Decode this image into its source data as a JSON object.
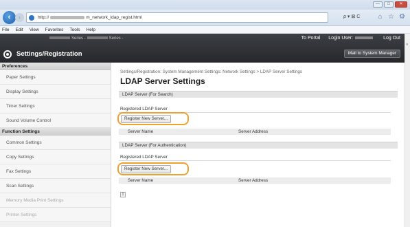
{
  "browser": {
    "back_icon": "back-arrow-icon",
    "url_prefix": "http://",
    "url_suffix": "m_network_ldap_regist.html",
    "search_control": "ρ ▾ ⊠ C",
    "window_controls": [
      "—",
      "□",
      "✕"
    ],
    "toolbar_icons": [
      "⌂",
      "☆",
      "⚙"
    ]
  },
  "menubar": [
    "File",
    "Edit",
    "View",
    "Favorites",
    "Tools",
    "Help"
  ],
  "header": {
    "device_info_left": "Series -",
    "device_info_right": "Series -",
    "to_portal": "To Portal",
    "login_user_label": "Login User:",
    "log_out": "Log Out",
    "title": "Settings/Registration",
    "mail_button": "Mail to System Manager"
  },
  "sidebar": {
    "preferences_heading": "Preferences",
    "preferences_items": [
      "Paper Settings",
      "Display Settings",
      "Timer Settings",
      "Sound Volume Control"
    ],
    "function_heading": "Function Settings",
    "function_items": [
      "Common Settings",
      "Copy Settings",
      "Fax Settings",
      "Scan Settings",
      "Memory Media Print Settings",
      "Printer Settings"
    ]
  },
  "main": {
    "breadcrumb": "Settings/Registration: System Management Settings: Network Settings > LDAP Server Settings",
    "title": "LDAP Server Settings",
    "search_section": {
      "heading": "LDAP Server (For Search)",
      "registered_label": "Registered LDAP Server",
      "register_button": "Register New Server...",
      "col_server_name": "Server Name",
      "col_server_address": "Server Address"
    },
    "auth_section": {
      "heading": "LDAP Server (For Authentication)",
      "registered_label": "Registered LDAP Server",
      "register_button": "Register New Server...",
      "col_server_name": "Server Name",
      "col_server_address": "Server Address"
    },
    "top_icon": "↥"
  },
  "colors": {
    "header_bg": "#2f3236",
    "highlight": "#f0a02e",
    "section_bg": "#e4e4e4"
  }
}
